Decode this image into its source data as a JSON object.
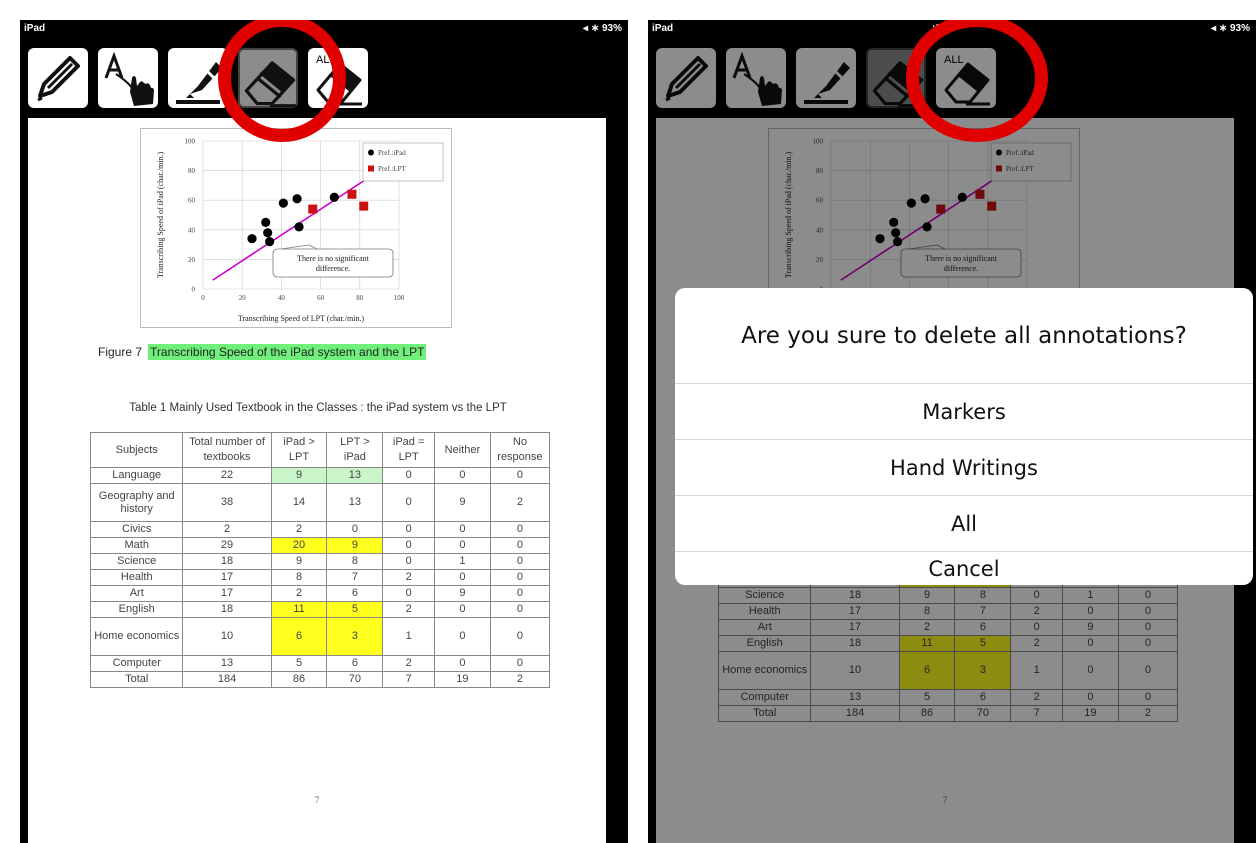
{
  "left": {
    "status": {
      "device": "iPad",
      "time": "13:",
      "battery": "◂ ∗ 93%"
    },
    "figure": {
      "label": "Figure 7",
      "caption": "Transcribing Speed of the iPad system and the LPT"
    },
    "table": {
      "caption": "Table 1    Mainly Used Textbook in the Classes : the iPad system vs the LPT",
      "headers": [
        "Subjects",
        "Total number of textbooks",
        "iPad > LPT",
        "LPT > iPad",
        "iPad = LPT",
        "Neither",
        "No response"
      ],
      "rows": [
        [
          "Language",
          "22",
          "9",
          "13",
          "0",
          "0",
          "0"
        ],
        [
          "Geography and history",
          "38",
          "14",
          "13",
          "0",
          "9",
          "2"
        ],
        [
          "Civics",
          "2",
          "2",
          "0",
          "0",
          "0",
          "0"
        ],
        [
          "Math",
          "29",
          "20",
          "9",
          "0",
          "0",
          "0"
        ],
        [
          "Science",
          "18",
          "9",
          "8",
          "0",
          "1",
          "0"
        ],
        [
          "Health",
          "17",
          "8",
          "7",
          "2",
          "0",
          "0"
        ],
        [
          "Art",
          "17",
          "2",
          "6",
          "0",
          "9",
          "0"
        ],
        [
          "English",
          "18",
          "11",
          "5",
          "2",
          "0",
          "0"
        ],
        [
          "Home economics",
          "10",
          "6",
          "3",
          "1",
          "0",
          "0"
        ],
        [
          "Computer",
          "13",
          "5",
          "6",
          "2",
          "0",
          "0"
        ],
        [
          "Total",
          "184",
          "86",
          "70",
          "7",
          "19",
          "2"
        ]
      ]
    },
    "page_number": "7"
  },
  "right": {
    "status": {
      "device": "iPad",
      "time": ":05",
      "battery": "◂ ∗ 93%"
    },
    "dialog": {
      "title": "Are you sure to delete all annotations?",
      "buttons": [
        "Markers",
        "Hand Writings",
        "All",
        "Cancel"
      ]
    },
    "table_rows": [
      [
        "Math",
        "29",
        "20",
        "9",
        "0",
        "0",
        "0"
      ],
      [
        "Science",
        "18",
        "9",
        "8",
        "0",
        "1",
        "0"
      ],
      [
        "Health",
        "17",
        "8",
        "7",
        "2",
        "0",
        "0"
      ],
      [
        "Art",
        "17",
        "2",
        "6",
        "0",
        "9",
        "0"
      ],
      [
        "English",
        "18",
        "11",
        "5",
        "2",
        "0",
        "0"
      ],
      [
        "Home economics",
        "10",
        "6",
        "3",
        "1",
        "0",
        "0"
      ],
      [
        "Computer",
        "13",
        "5",
        "6",
        "2",
        "0",
        "0"
      ],
      [
        "Total",
        "184",
        "86",
        "70",
        "7",
        "19",
        "2"
      ]
    ],
    "page_number": "7"
  },
  "toolbar": {
    "all_label": "ALL",
    "tools": [
      "pencil-icon",
      "text-cursor-icon",
      "marker-icon",
      "eraser-icon",
      "erase-all-icon"
    ]
  },
  "chart_data": {
    "type": "scatter",
    "xlabel": "Transcribing Speed of LPT (char./min.)",
    "ylabel": "Transcribing Speed of iPad (char./min.)",
    "xlim": [
      0,
      100
    ],
    "ylim": [
      0,
      100
    ],
    "xticks": [
      "0",
      "20",
      "40",
      "60",
      "80",
      "100"
    ],
    "yticks": [
      "0",
      "20",
      "40",
      "60",
      "80",
      "100"
    ],
    "annotation": "There is no significant difference.",
    "grid": true,
    "legend_position": "top-right",
    "series": [
      {
        "name": "Pref.:iPad",
        "color": "#000000",
        "marker": "circle",
        "x": [
          25,
          32,
          33,
          34,
          41,
          48,
          49,
          67
        ],
        "y": [
          34,
          45,
          38,
          32,
          58,
          61,
          42,
          62
        ]
      },
      {
        "name": "Pref.:LPT",
        "color": "#cc1111",
        "marker": "square",
        "x": [
          56,
          76,
          82
        ],
        "y": [
          54,
          64,
          56
        ]
      }
    ],
    "trendline": {
      "color": "#cc00cc",
      "x": [
        5,
        98
      ],
      "y": [
        6,
        87
      ]
    }
  },
  "colors": {
    "highlight_green": "#6ef07b",
    "highlight_yellow": "#ffff1e",
    "annotation_circle": "#e10000"
  }
}
